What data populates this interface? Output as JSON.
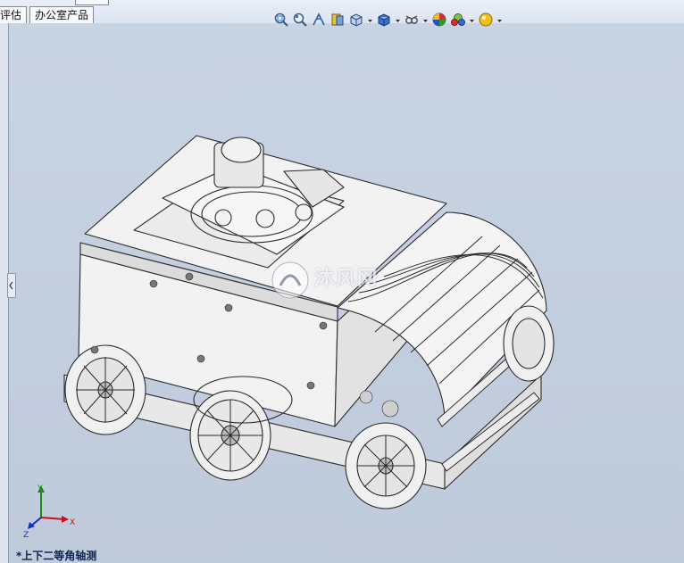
{
  "tabs": [
    {
      "label": "评估"
    },
    {
      "label": "办公室产品"
    }
  ],
  "toolbar": {
    "icons": [
      "zoom-to-fit-icon",
      "zoom-to-area-icon",
      "previous-view-icon",
      "section-view-icon",
      "view-orientation-icon",
      "display-style-icon",
      "hide-show-items-icon",
      "edit-appearance-icon",
      "apply-scene-icon",
      "view-settings-icon"
    ]
  },
  "viewport": {
    "view_name": "*上下二等角轴测",
    "watermark": "沐风网",
    "triad": {
      "x": "X",
      "y": "Y",
      "z": "Z"
    }
  },
  "colors": {
    "background": "#c6d1e1",
    "model_line": "#2a2a2a",
    "model_face": "#f2f2f2",
    "triad_x": "#d01010",
    "triad_y": "#1a8a1a",
    "triad_z": "#1030c0"
  }
}
